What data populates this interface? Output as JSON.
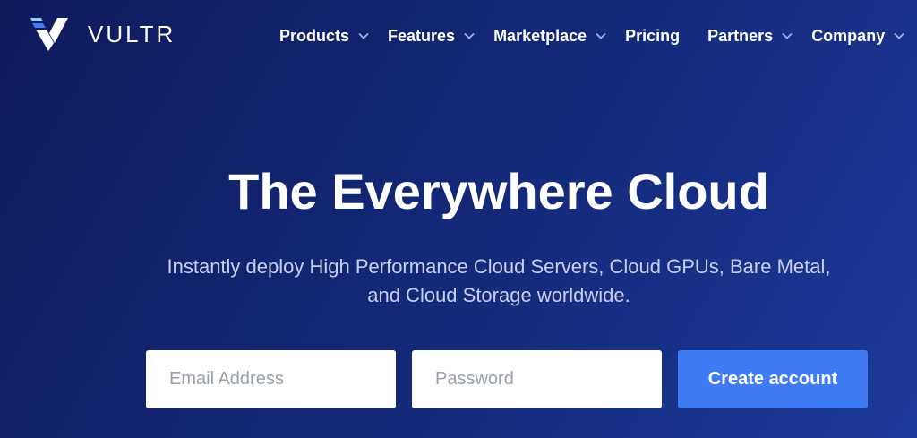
{
  "brand": {
    "name": "VULTR",
    "logo_icon": "vultr-v-logo-icon",
    "colors": {
      "primary_blue": "#3e7bf5",
      "logo_light": "#8fd0ff",
      "logo_mid": "#3e7bf5",
      "logo_white": "#ffffff"
    }
  },
  "nav": {
    "items": [
      {
        "label": "Products",
        "has_dropdown": true
      },
      {
        "label": "Features",
        "has_dropdown": true
      },
      {
        "label": "Marketplace",
        "has_dropdown": true
      },
      {
        "label": "Pricing",
        "has_dropdown": false
      },
      {
        "label": "Partners",
        "has_dropdown": true
      },
      {
        "label": "Company",
        "has_dropdown": true
      }
    ],
    "dropdown_icon": "chevron-down-icon"
  },
  "hero": {
    "title": "The Everywhere Cloud",
    "subtitle_line1": "Instantly deploy High Performance Cloud Servers, Cloud GPUs, Bare Metal,",
    "subtitle_line2": "and Cloud Storage worldwide."
  },
  "signup": {
    "email_placeholder": "Email Address",
    "email_value": "",
    "password_placeholder": "Password",
    "password_value": "",
    "submit_label": "Create account"
  }
}
